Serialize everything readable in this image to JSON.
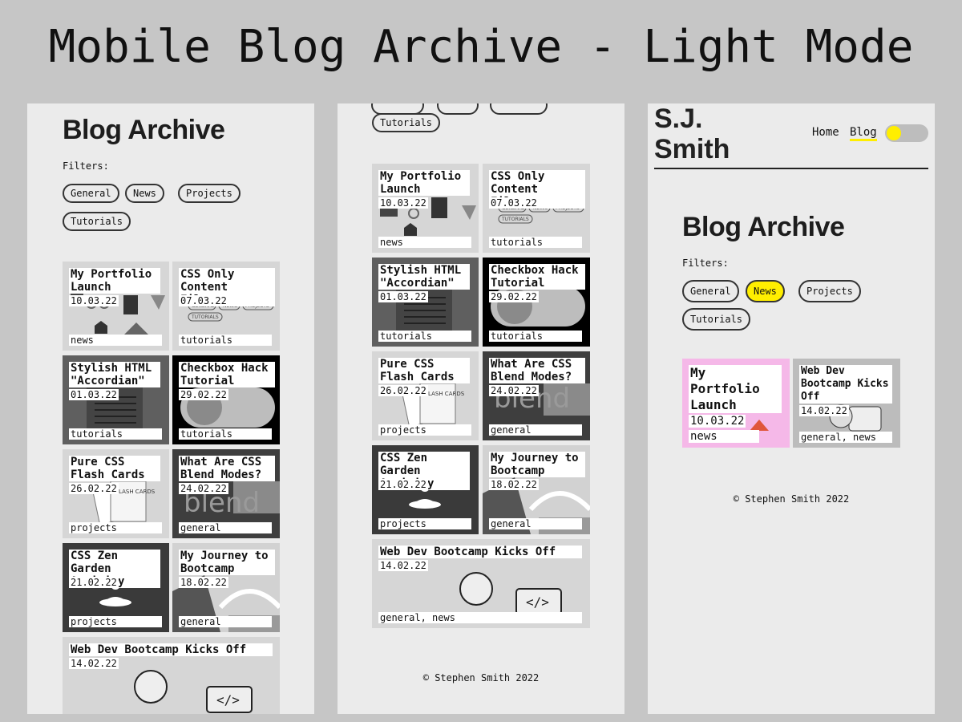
{
  "page_title": "Mobile Blog Archive - Light Mode",
  "archive": {
    "heading": "Blog Archive",
    "filters_label": "Filters:",
    "filters": [
      "General",
      "News",
      "Projects",
      "Tutorials"
    ],
    "posts": [
      {
        "title": "My Portfolio Launch",
        "date": "10.03.22",
        "tags": "news"
      },
      {
        "title": "CSS Only Content Filter",
        "date": "07.03.22",
        "tags": "tutorials"
      },
      {
        "title": "Stylish HTML \"Accordian\"",
        "date": "01.03.22",
        "tags": "tutorials"
      },
      {
        "title": "Checkbox Hack Tutorial",
        "date": "29.02.22",
        "tags": "tutorials"
      },
      {
        "title": "Pure CSS Flash Cards",
        "date": "26.02.22",
        "tags": "projects"
      },
      {
        "title": "What Are CSS Blend Modes?",
        "date": "24.02.22",
        "tags": "general"
      },
      {
        "title": "CSS Zen Garden Activity",
        "date": "21.02.22",
        "tags": "projects"
      },
      {
        "title": "My Journey to Bootcamp",
        "date": "18.02.22",
        "tags": "general"
      },
      {
        "title": "Web Dev Bootcamp Kicks Off",
        "date": "14.02.22",
        "tags": "general, news"
      }
    ],
    "filtered_posts": [
      {
        "title": "My Portfolio Launch",
        "date": "10.03.22",
        "tags": "news"
      },
      {
        "title": "Web Dev Bootcamp Kicks Off",
        "date": "14.02.22",
        "tags": "general, news"
      }
    ],
    "active_filter": "News",
    "image_text": {
      "mini_chips": [
        "GENERAL",
        "NEWS",
        "PROJECTS",
        "TUTORIALS"
      ],
      "flash_cards": "FLASH CARDS",
      "blend": "blend",
      "code_tag": "</>"
    }
  },
  "header": {
    "logo": "S.J. Smith",
    "nav": [
      "Home",
      "Blog"
    ]
  },
  "footer": "© Stephen Smith 2022",
  "colors": {
    "accent": "#ffee00",
    "filtered_card_bg": "#f5b8e8",
    "background": "#c6c6c6",
    "phone_bg": "#ebebeb"
  }
}
